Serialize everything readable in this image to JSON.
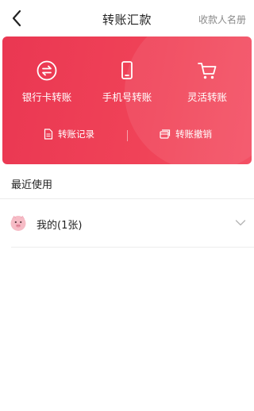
{
  "header": {
    "title": "转账汇款",
    "right_action": "收款人名册",
    "back_icon": "back-chevron-icon"
  },
  "card": {
    "colors": {
      "start": "#ea3752",
      "end": "#f35064"
    },
    "actions": [
      {
        "label": "银行卡转账",
        "icon": "exchange-icon"
      },
      {
        "label": "手机号转账",
        "icon": "phone-icon"
      },
      {
        "label": "灵活转账",
        "icon": "cart-icon"
      }
    ],
    "links": [
      {
        "label": "转账记录",
        "icon": "document-icon"
      },
      {
        "label": "转账撤销",
        "icon": "cards-icon"
      }
    ]
  },
  "recent": {
    "title": "最近使用",
    "items": [
      {
        "label": "我的(1张)",
        "icon": "pig-avatar-icon",
        "expand_icon": "chevron-down-icon"
      }
    ]
  }
}
